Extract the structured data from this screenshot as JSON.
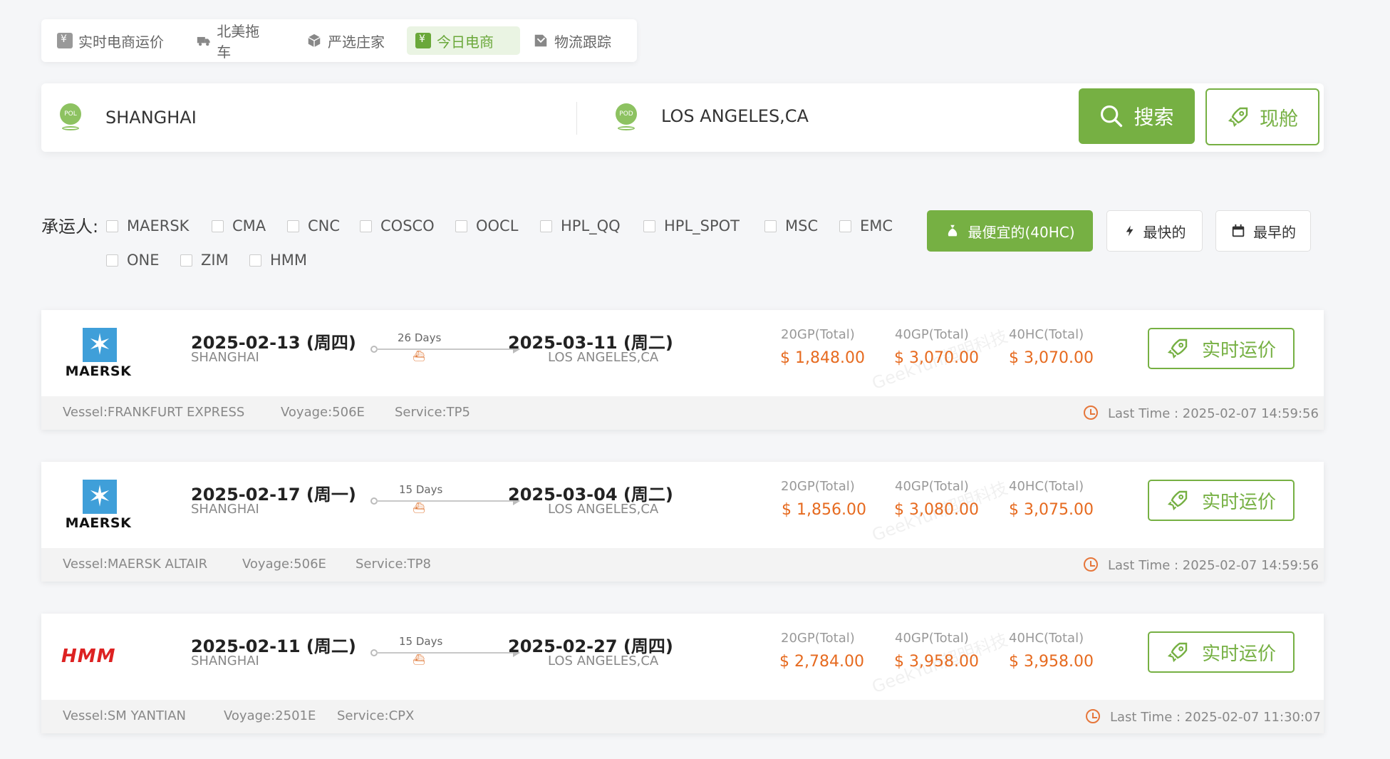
{
  "tabs": [
    {
      "label": "实时电商运价",
      "icon": "yen-box-icon",
      "active": false
    },
    {
      "label": "北美拖车",
      "icon": "truck-icon",
      "active": false
    },
    {
      "label": "严选庄家",
      "icon": "cube-icon",
      "active": false
    },
    {
      "label": "今日电商",
      "icon": "yen-box-icon",
      "active": true
    },
    {
      "label": "物流跟踪",
      "icon": "track-icon",
      "active": false
    }
  ],
  "search": {
    "pol_badge": "POL",
    "pol": "SHANGHAI",
    "pod_badge": "POD",
    "pod": "LOS ANGELES,CA",
    "search_label": "搜索",
    "spot_label": "现舱"
  },
  "filter": {
    "label": "承运人:",
    "carriers": [
      "MAERSK",
      "CMA",
      "CNC",
      "COSCO",
      "OOCL",
      "HPL_QQ",
      "HPL_SPOT",
      "MSC",
      "EMC",
      "ONE",
      "ZIM",
      "HMM"
    ]
  },
  "sort": {
    "cheapest": "最便宜的(40HC)",
    "fastest": "最快的",
    "earliest": "最早的"
  },
  "price_labels": {
    "gp20": "20GP(Total)",
    "gp40": "40GP(Total)",
    "hc40": "40HC(Total)"
  },
  "realtime_label": "实时运价",
  "watermark": "GeekYun超明科技",
  "results": [
    {
      "carrier": "MAERSK",
      "dep_date": "2025-02-13 (周四)",
      "dep_port": "SHANGHAI",
      "days": "26 Days",
      "arr_date": "2025-03-11 (周二)",
      "arr_port": "LOS ANGELES,CA",
      "p20": "$ 1,848.00",
      "p40": "$ 3,070.00",
      "p40hc": "$ 3,070.00",
      "vessel": "Vessel:FRANKFURT EXPRESS",
      "voyage": "Voyage:506E",
      "service": "Service:TP5",
      "last_time": "Last Time : 2025-02-07 14:59:56"
    },
    {
      "carrier": "MAERSK",
      "dep_date": "2025-02-17 (周一)",
      "dep_port": "SHANGHAI",
      "days": "15 Days",
      "arr_date": "2025-03-04 (周二)",
      "arr_port": "LOS ANGELES,CA",
      "p20": "$ 1,856.00",
      "p40": "$ 3,080.00",
      "p40hc": "$ 3,075.00",
      "vessel": "Vessel:MAERSK ALTAIR",
      "voyage": "Voyage:506E",
      "service": "Service:TP8",
      "last_time": "Last Time : 2025-02-07 14:59:56"
    },
    {
      "carrier": "HMM",
      "dep_date": "2025-02-11 (周二)",
      "dep_port": "SHANGHAI",
      "days": "15 Days",
      "arr_date": "2025-02-27 (周四)",
      "arr_port": "LOS ANGELES,CA",
      "p20": "$ 2,784.00",
      "p40": "$ 3,958.00",
      "p40hc": "$ 3,958.00",
      "vessel": "Vessel:SM YANTIAN",
      "voyage": "Voyage:2501E",
      "service": "Service:CPX",
      "last_time": "Last Time : 2025-02-07 11:30:07"
    }
  ],
  "colors": {
    "accent": "#76b043",
    "price": "#e66a1f",
    "background": "#f5f6f8"
  }
}
